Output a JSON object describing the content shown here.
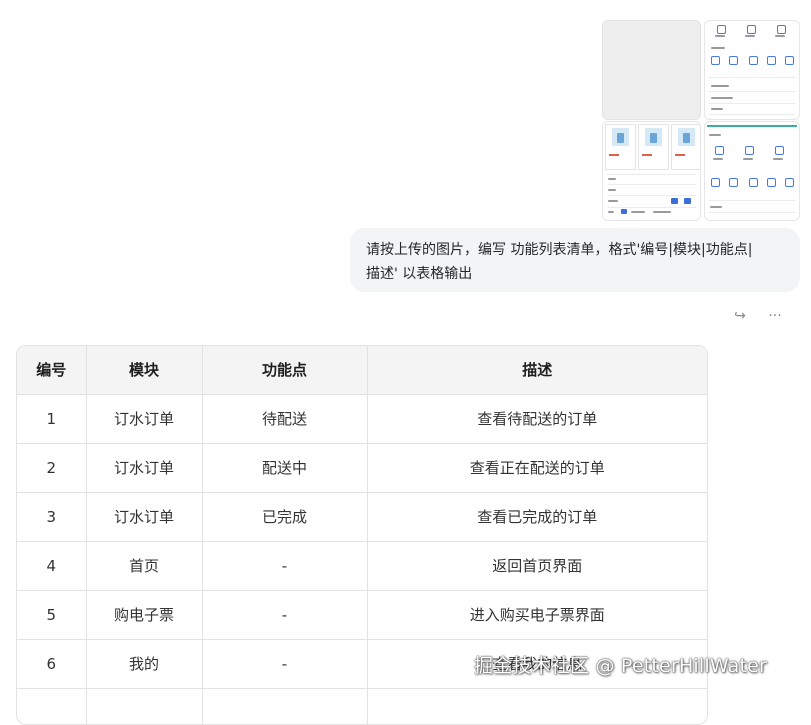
{
  "message": {
    "line1": "请按上传的图片，编写 功能列表清单，格式'编号|模块|功能点|",
    "line2": "描述' 以表格输出"
  },
  "actions": {
    "share_icon": "↪",
    "more_icon": "···"
  },
  "table": {
    "headers": [
      "编号",
      "模块",
      "功能点",
      "描述"
    ],
    "rows": [
      [
        "1",
        "订水订单",
        "待配送",
        "查看待配送的订单"
      ],
      [
        "2",
        "订水订单",
        "配送中",
        "查看正在配送的订单"
      ],
      [
        "3",
        "订水订单",
        "已完成",
        "查看已完成的订单"
      ],
      [
        "4",
        "首页",
        "-",
        "返回首页界面"
      ],
      [
        "5",
        "购电子票",
        "-",
        "进入购买电子票界面"
      ],
      [
        "6",
        "我的",
        "-",
        "查看我的信息"
      ],
      [
        "",
        "",
        "",
        ""
      ]
    ]
  },
  "watermark": "掘金技术社区 @ PetterHillWater",
  "colors": {
    "bubble": "#f3f4f6",
    "header_bg": "#f4f4f5",
    "border": "#e2e2e2"
  }
}
